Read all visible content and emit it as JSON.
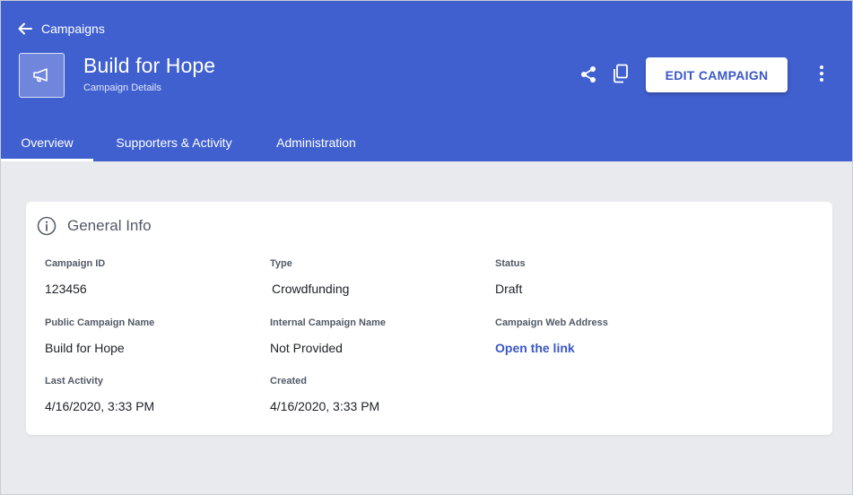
{
  "header": {
    "back_label": "Campaigns",
    "title": "Build for Hope",
    "subtitle": "Campaign Details",
    "edit_label": "EDIT CAMPAIGN",
    "campaign_icon": "megaphone-icon",
    "actions": [
      "share-icon",
      "copy-icon",
      "more-vertical-icon"
    ]
  },
  "tabs": [
    {
      "label": "Overview",
      "active": true
    },
    {
      "label": "Supporters & Activity",
      "active": false
    },
    {
      "label": "Administration",
      "active": false
    }
  ],
  "general_info": {
    "title": "General Info",
    "icon": "info-icon",
    "fields": {
      "campaign_id": {
        "label": "Campaign ID",
        "value": "123456"
      },
      "type": {
        "label": "Type",
        "value": "Crowdfunding"
      },
      "status": {
        "label": "Status",
        "value": "Draft"
      },
      "public_name": {
        "label": "Public Campaign Name",
        "value": "Build for Hope"
      },
      "internal_name": {
        "label": "Internal Campaign Name",
        "value": "Not Provided"
      },
      "web_address": {
        "label": "Campaign Web Address",
        "value": "Open the link"
      },
      "last_activity": {
        "label": "Last Activity",
        "value": "4/16/2020, 3:33 PM"
      },
      "created": {
        "label": "Created",
        "value": "4/16/2020, 3:33 PM"
      }
    }
  },
  "colors": {
    "header_bg": "#4060d0",
    "page_bg": "#e8eaee",
    "accent": "#3a57c8"
  }
}
